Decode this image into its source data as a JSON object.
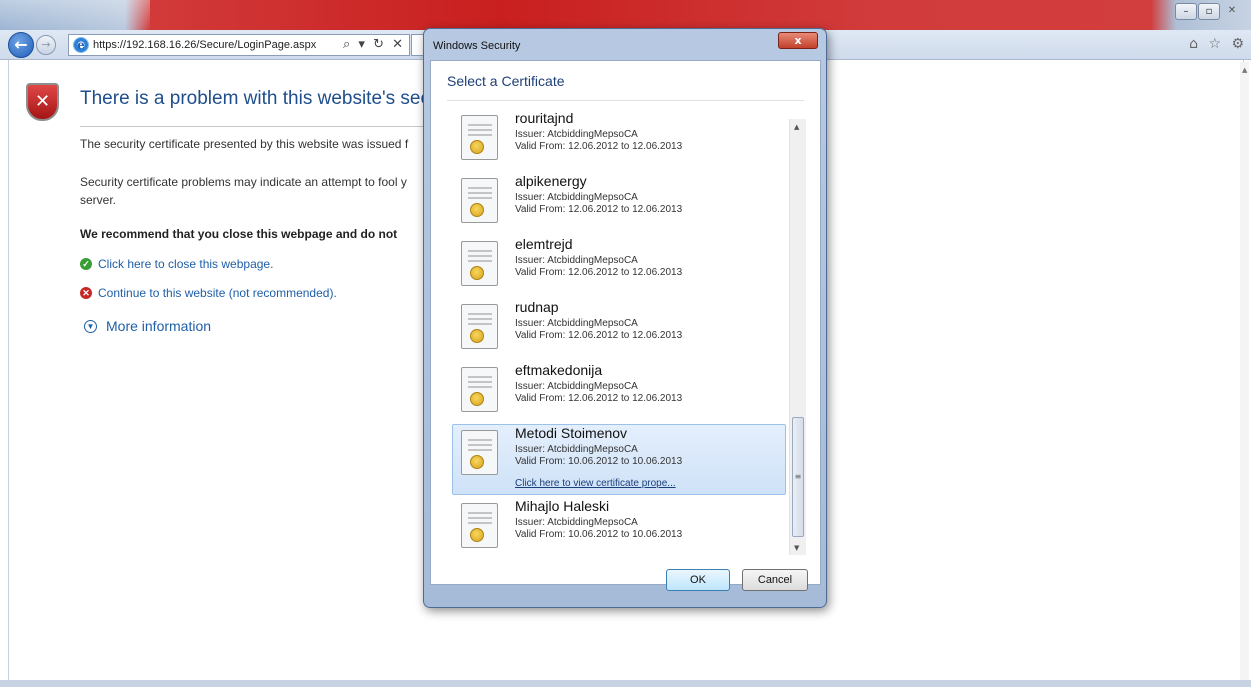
{
  "browser": {
    "url": "https://192.168.16.26/Secure/LoginPage.aspx",
    "address_tools": "⌕ ▾ ↻ ✕",
    "right_icons": "⌂ ☆ ⚙",
    "window_buttons": [
      "–",
      "▫",
      "✕"
    ]
  },
  "page": {
    "title": "There is a problem with this website's security c",
    "para1": "The security certificate presented by this website was issued f",
    "para2": "Security certificate problems may indicate an attempt to fool y server.",
    "recommend": "We recommend that you close this webpage and do not",
    "close_link": "Click here to close this webpage.",
    "continue_link": "Continue to this website (not recommended).",
    "more_info": "More information"
  },
  "dialog": {
    "title": "Windows Security",
    "close_label": "x",
    "heading": "Select a Certificate",
    "view_link": "Click here to view certificate prope...",
    "ok_label": "OK",
    "cancel_label": "Cancel",
    "certificates": [
      {
        "name": "rouritajnd",
        "issuer": "Issuer: AtcbiddingMepsoCA",
        "valid": "Valid From: 12.06.2012 to 12.06.2013"
      },
      {
        "name": "alpikenergy",
        "issuer": "Issuer: AtcbiddingMepsoCA",
        "valid": "Valid From: 12.06.2012 to 12.06.2013"
      },
      {
        "name": "elemtrejd",
        "issuer": "Issuer: AtcbiddingMepsoCA",
        "valid": "Valid From: 12.06.2012 to 12.06.2013"
      },
      {
        "name": "rudnap",
        "issuer": "Issuer: AtcbiddingMepsoCA",
        "valid": "Valid From: 12.06.2012 to 12.06.2013"
      },
      {
        "name": "eftmakedonija",
        "issuer": "Issuer: AtcbiddingMepsoCA",
        "valid": "Valid From: 12.06.2012 to 12.06.2013"
      },
      {
        "name": "Metodi Stoimenov",
        "issuer": "Issuer: AtcbiddingMepsoCA",
        "valid": "Valid From: 10.06.2012 to 10.06.2013"
      },
      {
        "name": "Mihajlo Haleski",
        "issuer": "Issuer: AtcbiddingMepsoCA",
        "valid": "Valid From: 10.06.2012 to 10.06.2013"
      }
    ],
    "selected_index": 5
  }
}
